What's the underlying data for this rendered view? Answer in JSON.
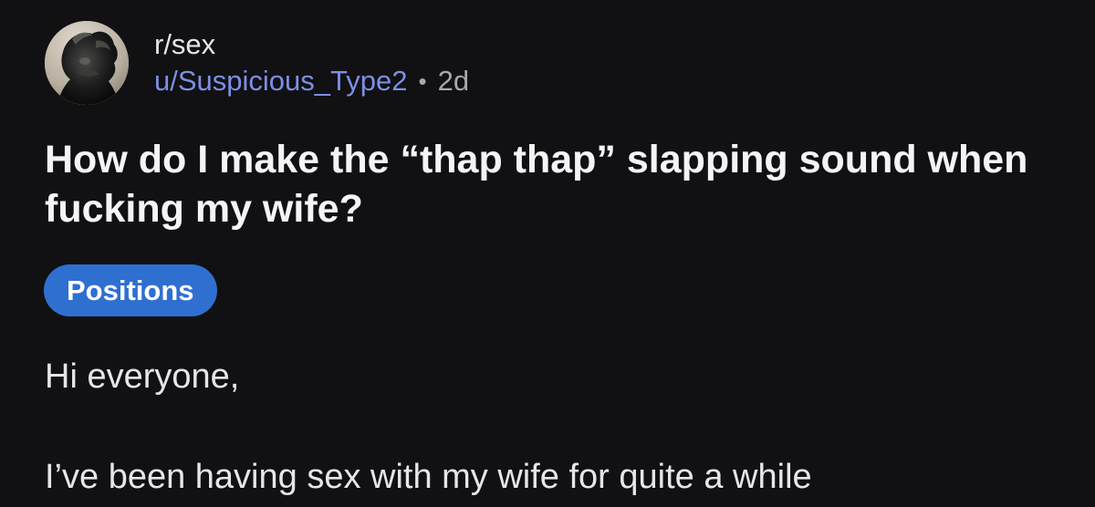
{
  "post": {
    "subreddit": "r/sex",
    "author": "u/Suspicious_Type2",
    "separator": "•",
    "age": "2d",
    "title": "How do I make the “thap thap” slapping sound when fucking my wife?",
    "flair": "Positions",
    "body": {
      "greeting": "Hi everyone,",
      "line1": "I’ve been having sex with my wife for quite a while"
    }
  },
  "colors": {
    "background": "#111113",
    "username": "#7d8fe4",
    "flair_bg": "#2f6fd0"
  },
  "icons": {
    "avatar": "subreddit-avatar-statue"
  }
}
